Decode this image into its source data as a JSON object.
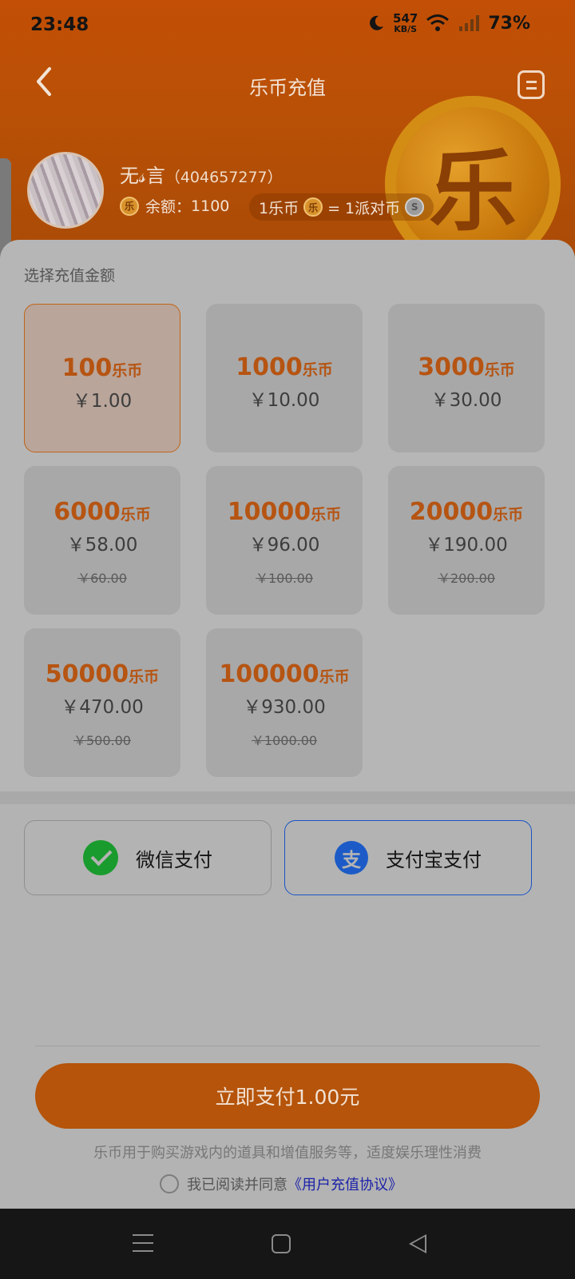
{
  "status_bar": {
    "time": "23:48",
    "net_speed_value": "547",
    "net_speed_unit": "KB/S",
    "battery": "73%"
  },
  "header": {
    "title": "乐币充值",
    "coin_char": "乐"
  },
  "user": {
    "name": "无𝓈言",
    "id": "（404657277）",
    "balance_label": "余额：",
    "balance_value": "1100"
  },
  "rate": {
    "left": "1乐币",
    "right": "= 1派对币",
    "coin_char": "乐",
    "party_char": "S"
  },
  "section_label": "选择充值金额",
  "packages": [
    {
      "amount": "100",
      "unit": "乐币",
      "price": "￥1.00",
      "original": ""
    },
    {
      "amount": "1000",
      "unit": "乐币",
      "price": "￥10.00",
      "original": ""
    },
    {
      "amount": "3000",
      "unit": "乐币",
      "price": "￥30.00",
      "original": ""
    },
    {
      "amount": "6000",
      "unit": "乐币",
      "price": "￥58.00",
      "original": "￥60.00"
    },
    {
      "amount": "10000",
      "unit": "乐币",
      "price": "￥96.00",
      "original": "￥100.00"
    },
    {
      "amount": "20000",
      "unit": "乐币",
      "price": "￥190.00",
      "original": "￥200.00"
    },
    {
      "amount": "50000",
      "unit": "乐币",
      "price": "￥470.00",
      "original": "￥500.00"
    },
    {
      "amount": "100000",
      "unit": "乐币",
      "price": "￥930.00",
      "original": "￥1000.00"
    }
  ],
  "payment": {
    "wechat": "微信支付",
    "alipay": "支付宝支付",
    "alipay_char": "支"
  },
  "pay_button": "立即支付1.00元",
  "notice": "乐币用于购买游戏内的道具和增值服务等，适度娱乐理性消费",
  "agreement": {
    "text": "我已阅读并同意",
    "link": "《用户充值协议》"
  },
  "colors": {
    "accent": "#b5540a",
    "alipay_blue": "#1c5bc7",
    "wechat_green": "#1a9b2d"
  }
}
